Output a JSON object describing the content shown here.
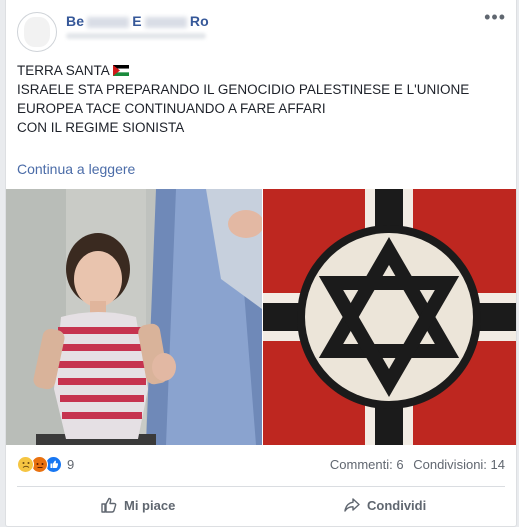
{
  "post": {
    "author_visible": "Be",
    "author_visible_2": "E",
    "author_visible_3": "Ro",
    "text_line1": "TERRA SANTA",
    "text_line2": "ISRAELE STA PREPARANDO IL GENOCIDIO PALESTINESE E L'UNIONE",
    "text_line3": "EUROPEA TACE CONTINUANDO A FARE AFFARI",
    "text_line4": "CON IL REGIME SIONISTA",
    "read_more": "Continua a leggere",
    "more_icon": "•••"
  },
  "stats": {
    "reaction_count": "9",
    "comments": "Commenti: 6",
    "shares": "Condivisioni: 14",
    "reaction_icons": [
      "sad-icon",
      "angry-icon",
      "like-icon"
    ]
  },
  "actions": {
    "like_label": "Mi piace",
    "share_label": "Condividi"
  },
  "colors": {
    "link": "#365899",
    "read_more": "#4b6ca8",
    "muted": "#616770",
    "flag_red": "#d11a1a",
    "flag_green": "#1b8a3c"
  }
}
